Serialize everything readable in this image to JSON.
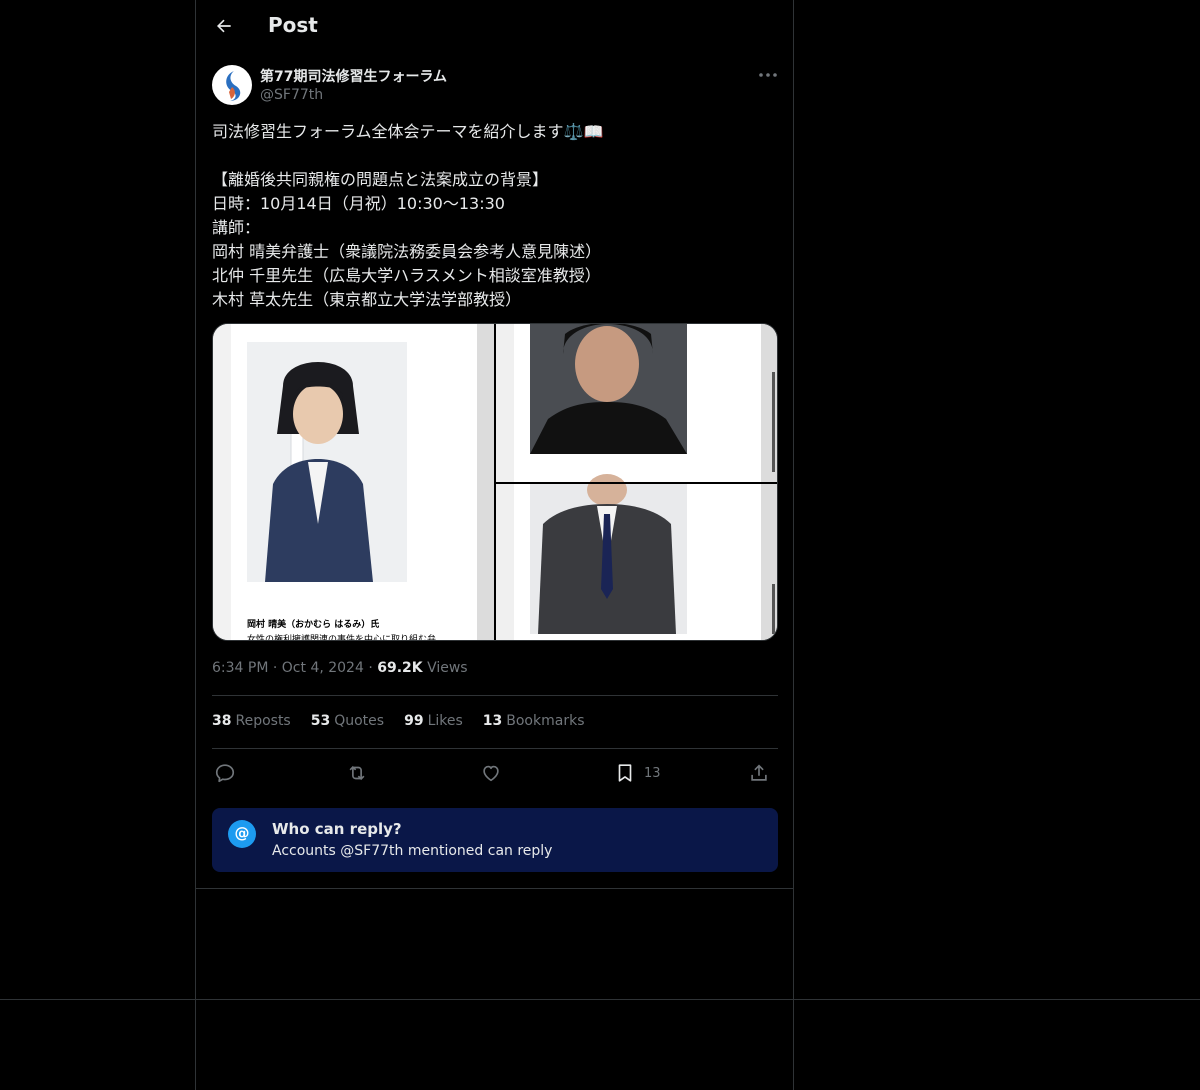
{
  "header": {
    "title": "Post"
  },
  "post": {
    "author_name": "第77期司法修習生フォーラム",
    "author_handle": "@SF77th",
    "text": "司法修習生フォーラム全体会テーマを紹介します⚖️📖\n\n【離婚後共同親権の問題点と法案成立の背景】\n日時：10月14日（月祝）10:30〜13:30\n講師：\n岡村 晴美弁護士（衆議院法務委員会参考人意見陳述）\n北仲 千里先生（広島大学ハラスメント相談室准教授）\n木村 草太先生（東京都立大学法学部教授）",
    "media_caption_name": "岡村 晴美（おかむら はるみ）氏",
    "media_caption_text": "女性の権利擁護関連の事件を中心に取り組む弁",
    "time": "6:34 PM",
    "date": "Oct 4, 2024",
    "views_count": "69.2K",
    "views_label": "Views"
  },
  "stats": {
    "reposts_count": "38",
    "reposts_label": "Reposts",
    "quotes_count": "53",
    "quotes_label": "Quotes",
    "likes_count": "99",
    "likes_label": "Likes",
    "bookmarks_count": "13",
    "bookmarks_label": "Bookmarks"
  },
  "actions": {
    "bookmark_count": "13"
  },
  "reply_restriction": {
    "title": "Who can reply?",
    "subtitle_prefix": "Accounts ",
    "subtitle_mention": "@SF77th",
    "subtitle_suffix": " mentioned can reply"
  },
  "icons": [
    "back-arrow-icon",
    "more-icon",
    "reply-icon",
    "repost-icon",
    "like-icon",
    "bookmark-icon",
    "share-icon",
    "at-icon"
  ],
  "colors": {
    "background": "#000000",
    "text": "#e7e9ea",
    "muted": "#71767b",
    "accent": "#1d9bf0",
    "reply_box": "#0a1748"
  }
}
